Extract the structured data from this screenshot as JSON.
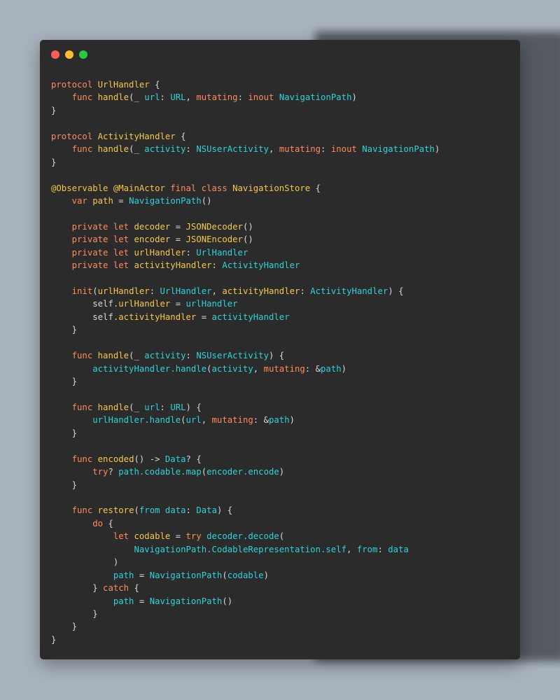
{
  "window": {
    "controls": [
      "close",
      "minimize",
      "maximize"
    ]
  },
  "colors": {
    "background": "#a9b3bd",
    "window": "#2b2b2b",
    "keyword": "#ff8a5c",
    "identifier": "#f5c84c",
    "type": "#2dd4d9",
    "plain": "#d8d8d8"
  },
  "code": {
    "language": "swift",
    "lines": [
      [
        {
          "t": "protocol ",
          "c": "kw"
        },
        {
          "t": "UrlHandler",
          "c": "fn"
        },
        {
          "t": " {",
          "c": "pl"
        }
      ],
      [
        {
          "t": "    ",
          "c": "pl"
        },
        {
          "t": "func ",
          "c": "kw"
        },
        {
          "t": "handle",
          "c": "fn"
        },
        {
          "t": "(_ ",
          "c": "pl"
        },
        {
          "t": "url",
          "c": "ty"
        },
        {
          "t": ": ",
          "c": "pl"
        },
        {
          "t": "URL",
          "c": "ty"
        },
        {
          "t": ", ",
          "c": "pl"
        },
        {
          "t": "mutating",
          "c": "kw"
        },
        {
          "t": ": ",
          "c": "pl"
        },
        {
          "t": "inout ",
          "c": "kw"
        },
        {
          "t": "NavigationPath",
          "c": "ty"
        },
        {
          "t": ")",
          "c": "pl"
        }
      ],
      [
        {
          "t": "}",
          "c": "pl"
        }
      ],
      [],
      [
        {
          "t": "protocol ",
          "c": "kw"
        },
        {
          "t": "ActivityHandler",
          "c": "fn"
        },
        {
          "t": " {",
          "c": "pl"
        }
      ],
      [
        {
          "t": "    ",
          "c": "pl"
        },
        {
          "t": "func ",
          "c": "kw"
        },
        {
          "t": "handle",
          "c": "fn"
        },
        {
          "t": "(_ ",
          "c": "pl"
        },
        {
          "t": "activity",
          "c": "ty"
        },
        {
          "t": ": ",
          "c": "pl"
        },
        {
          "t": "NSUserActivity",
          "c": "ty"
        },
        {
          "t": ", ",
          "c": "pl"
        },
        {
          "t": "mutating",
          "c": "kw"
        },
        {
          "t": ": ",
          "c": "pl"
        },
        {
          "t": "inout ",
          "c": "kw"
        },
        {
          "t": "NavigationPath",
          "c": "ty"
        },
        {
          "t": ")",
          "c": "pl"
        }
      ],
      [
        {
          "t": "}",
          "c": "pl"
        }
      ],
      [],
      [
        {
          "t": "@Observable @MainActor ",
          "c": "at"
        },
        {
          "t": "final class ",
          "c": "kw"
        },
        {
          "t": "NavigationStore",
          "c": "fn"
        },
        {
          "t": " {",
          "c": "pl"
        }
      ],
      [
        {
          "t": "    ",
          "c": "pl"
        },
        {
          "t": "var ",
          "c": "kw"
        },
        {
          "t": "path",
          "c": "fn"
        },
        {
          "t": " = ",
          "c": "pl"
        },
        {
          "t": "NavigationPath",
          "c": "ty"
        },
        {
          "t": "()",
          "c": "pl"
        }
      ],
      [],
      [
        {
          "t": "    ",
          "c": "pl"
        },
        {
          "t": "private let ",
          "c": "kw"
        },
        {
          "t": "decoder",
          "c": "fn"
        },
        {
          "t": " = ",
          "c": "pl"
        },
        {
          "t": "JSONDecoder",
          "c": "fn"
        },
        {
          "t": "()",
          "c": "pl"
        }
      ],
      [
        {
          "t": "    ",
          "c": "pl"
        },
        {
          "t": "private let ",
          "c": "kw"
        },
        {
          "t": "encoder",
          "c": "fn"
        },
        {
          "t": " = ",
          "c": "pl"
        },
        {
          "t": "JSONEncoder",
          "c": "fn"
        },
        {
          "t": "()",
          "c": "pl"
        }
      ],
      [
        {
          "t": "    ",
          "c": "pl"
        },
        {
          "t": "private let ",
          "c": "kw"
        },
        {
          "t": "urlHandler",
          "c": "fn"
        },
        {
          "t": ": ",
          "c": "pl"
        },
        {
          "t": "UrlHandler",
          "c": "ty"
        }
      ],
      [
        {
          "t": "    ",
          "c": "pl"
        },
        {
          "t": "private let ",
          "c": "kw"
        },
        {
          "t": "activityHandler",
          "c": "fn"
        },
        {
          "t": ": ",
          "c": "pl"
        },
        {
          "t": "ActivityHandler",
          "c": "ty"
        }
      ],
      [],
      [
        {
          "t": "    ",
          "c": "pl"
        },
        {
          "t": "init",
          "c": "kw"
        },
        {
          "t": "(",
          "c": "pl"
        },
        {
          "t": "urlHandler",
          "c": "fn"
        },
        {
          "t": ": ",
          "c": "pl"
        },
        {
          "t": "UrlHandler",
          "c": "ty"
        },
        {
          "t": ", ",
          "c": "pl"
        },
        {
          "t": "activityHandler",
          "c": "fn"
        },
        {
          "t": ": ",
          "c": "pl"
        },
        {
          "t": "ActivityHandler",
          "c": "ty"
        },
        {
          "t": ") {",
          "c": "pl"
        }
      ],
      [
        {
          "t": "        ",
          "c": "pl"
        },
        {
          "t": "self",
          "c": "pl"
        },
        {
          "t": ".urlHandler",
          "c": "fn"
        },
        {
          "t": " = ",
          "c": "pl"
        },
        {
          "t": "urlHandler",
          "c": "ty"
        }
      ],
      [
        {
          "t": "        ",
          "c": "pl"
        },
        {
          "t": "self",
          "c": "pl"
        },
        {
          "t": ".activityHandler",
          "c": "fn"
        },
        {
          "t": " = ",
          "c": "pl"
        },
        {
          "t": "activityHandler",
          "c": "ty"
        }
      ],
      [
        {
          "t": "    }",
          "c": "pl"
        }
      ],
      [],
      [
        {
          "t": "    ",
          "c": "pl"
        },
        {
          "t": "func ",
          "c": "kw"
        },
        {
          "t": "handle",
          "c": "fn"
        },
        {
          "t": "(_ ",
          "c": "pl"
        },
        {
          "t": "activity",
          "c": "ty"
        },
        {
          "t": ": ",
          "c": "pl"
        },
        {
          "t": "NSUserActivity",
          "c": "ty"
        },
        {
          "t": ") {",
          "c": "pl"
        }
      ],
      [
        {
          "t": "        ",
          "c": "pl"
        },
        {
          "t": "activityHandler.handle",
          "c": "ty"
        },
        {
          "t": "(",
          "c": "pl"
        },
        {
          "t": "activity",
          "c": "ty"
        },
        {
          "t": ", ",
          "c": "pl"
        },
        {
          "t": "mutating",
          "c": "kw"
        },
        {
          "t": ": &",
          "c": "pl"
        },
        {
          "t": "path",
          "c": "ty"
        },
        {
          "t": ")",
          "c": "pl"
        }
      ],
      [
        {
          "t": "    }",
          "c": "pl"
        }
      ],
      [],
      [
        {
          "t": "    ",
          "c": "pl"
        },
        {
          "t": "func ",
          "c": "kw"
        },
        {
          "t": "handle",
          "c": "fn"
        },
        {
          "t": "(_ ",
          "c": "pl"
        },
        {
          "t": "url",
          "c": "ty"
        },
        {
          "t": ": ",
          "c": "pl"
        },
        {
          "t": "URL",
          "c": "ty"
        },
        {
          "t": ") {",
          "c": "pl"
        }
      ],
      [
        {
          "t": "        ",
          "c": "pl"
        },
        {
          "t": "urlHandler.handle",
          "c": "ty"
        },
        {
          "t": "(",
          "c": "pl"
        },
        {
          "t": "url",
          "c": "ty"
        },
        {
          "t": ", ",
          "c": "pl"
        },
        {
          "t": "mutating",
          "c": "kw"
        },
        {
          "t": ": &",
          "c": "pl"
        },
        {
          "t": "path",
          "c": "ty"
        },
        {
          "t": ")",
          "c": "pl"
        }
      ],
      [
        {
          "t": "    }",
          "c": "pl"
        }
      ],
      [],
      [
        {
          "t": "    ",
          "c": "pl"
        },
        {
          "t": "func ",
          "c": "kw"
        },
        {
          "t": "encoded",
          "c": "fn"
        },
        {
          "t": "() -> ",
          "c": "pl"
        },
        {
          "t": "Data",
          "c": "ty"
        },
        {
          "t": "? {",
          "c": "pl"
        }
      ],
      [
        {
          "t": "        ",
          "c": "pl"
        },
        {
          "t": "try",
          "c": "kw"
        },
        {
          "t": "? ",
          "c": "pl"
        },
        {
          "t": "path.codable.map",
          "c": "ty"
        },
        {
          "t": "(",
          "c": "pl"
        },
        {
          "t": "encoder.encode",
          "c": "ty"
        },
        {
          "t": ")",
          "c": "pl"
        }
      ],
      [
        {
          "t": "    }",
          "c": "pl"
        }
      ],
      [],
      [
        {
          "t": "    ",
          "c": "pl"
        },
        {
          "t": "func ",
          "c": "kw"
        },
        {
          "t": "restore",
          "c": "fn"
        },
        {
          "t": "(",
          "c": "pl"
        },
        {
          "t": "from ",
          "c": "ty"
        },
        {
          "t": "data",
          "c": "ty"
        },
        {
          "t": ": ",
          "c": "pl"
        },
        {
          "t": "Data",
          "c": "ty"
        },
        {
          "t": ") {",
          "c": "pl"
        }
      ],
      [
        {
          "t": "        ",
          "c": "pl"
        },
        {
          "t": "do",
          "c": "kw"
        },
        {
          "t": " {",
          "c": "pl"
        }
      ],
      [
        {
          "t": "            ",
          "c": "pl"
        },
        {
          "t": "let ",
          "c": "kw"
        },
        {
          "t": "codable",
          "c": "fn"
        },
        {
          "t": " = ",
          "c": "pl"
        },
        {
          "t": "try ",
          "c": "kw"
        },
        {
          "t": "decoder.decode",
          "c": "ty"
        },
        {
          "t": "(",
          "c": "pl"
        }
      ],
      [
        {
          "t": "                ",
          "c": "pl"
        },
        {
          "t": "NavigationPath.CodableRepresentation.self",
          "c": "ty"
        },
        {
          "t": ", ",
          "c": "pl"
        },
        {
          "t": "from",
          "c": "ty"
        },
        {
          "t": ": ",
          "c": "pl"
        },
        {
          "t": "data",
          "c": "ty"
        }
      ],
      [
        {
          "t": "            )",
          "c": "pl"
        }
      ],
      [
        {
          "t": "            ",
          "c": "pl"
        },
        {
          "t": "path",
          "c": "ty"
        },
        {
          "t": " = ",
          "c": "pl"
        },
        {
          "t": "NavigationPath",
          "c": "ty"
        },
        {
          "t": "(",
          "c": "pl"
        },
        {
          "t": "codable",
          "c": "ty"
        },
        {
          "t": ")",
          "c": "pl"
        }
      ],
      [
        {
          "t": "        } ",
          "c": "pl"
        },
        {
          "t": "catch",
          "c": "kw"
        },
        {
          "t": " {",
          "c": "pl"
        }
      ],
      [
        {
          "t": "            ",
          "c": "pl"
        },
        {
          "t": "path",
          "c": "ty"
        },
        {
          "t": " = ",
          "c": "pl"
        },
        {
          "t": "NavigationPath",
          "c": "ty"
        },
        {
          "t": "()",
          "c": "pl"
        }
      ],
      [
        {
          "t": "        }",
          "c": "pl"
        }
      ],
      [
        {
          "t": "    }",
          "c": "pl"
        }
      ],
      [
        {
          "t": "}",
          "c": "pl"
        }
      ]
    ]
  }
}
